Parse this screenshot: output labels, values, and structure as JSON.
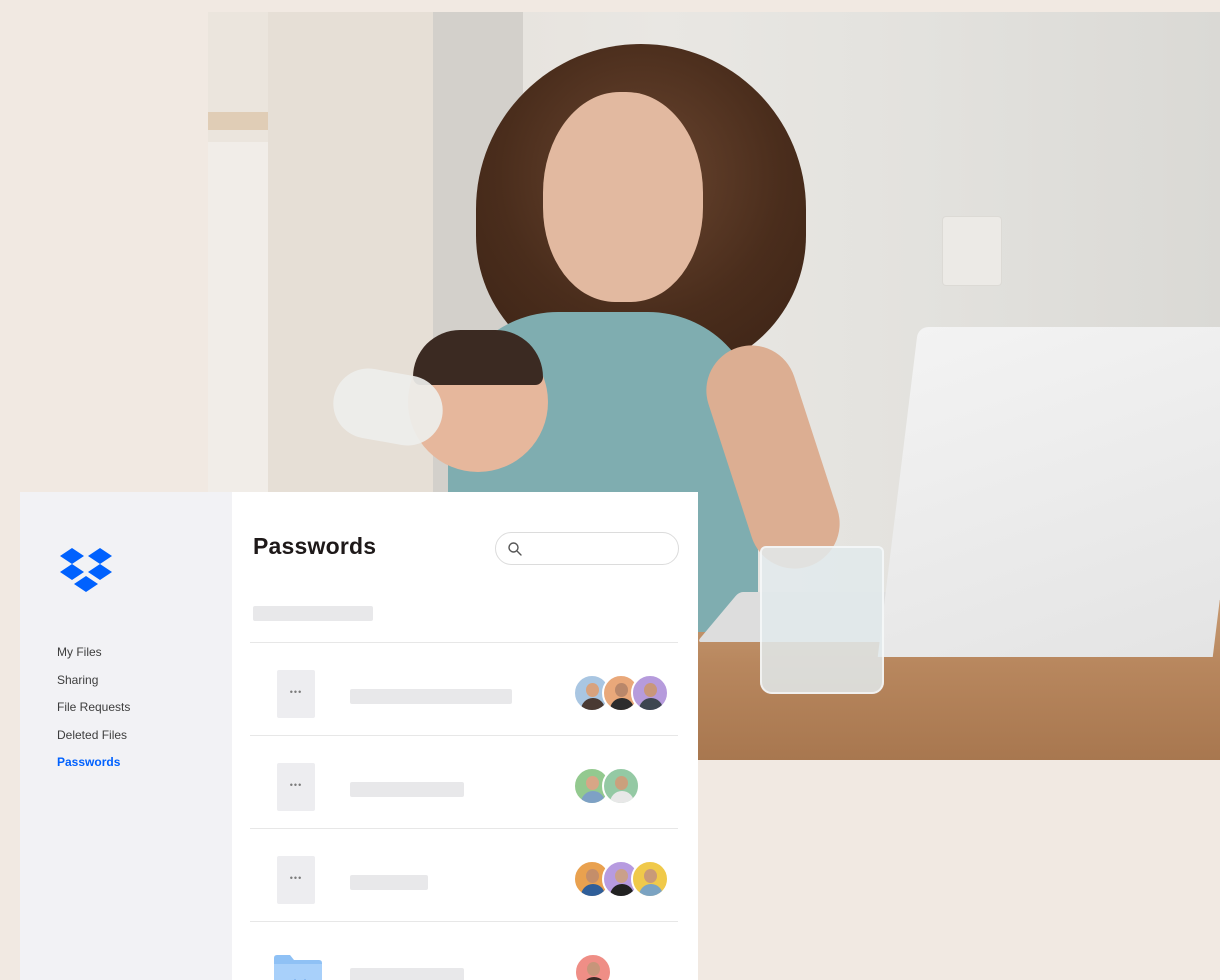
{
  "sidebar": {
    "nav": [
      "My Files",
      "Sharing",
      "File Requests",
      "Deleted Files",
      "Passwords"
    ],
    "active": "Passwords"
  },
  "main": {
    "title": "Passwords",
    "search": {
      "value": "",
      "placeholder": ""
    },
    "rows": [
      {
        "tile": "dots-icon",
        "dots": "•••",
        "avatars": [
          "#a9c6e2",
          "#e9a87a",
          "#b69bdc"
        ]
      },
      {
        "tile": "dots-icon",
        "dots": "•••",
        "avatars": [
          "#93c98f",
          "#94c9a4"
        ]
      },
      {
        "tile": "dots-icon",
        "dots": "•••",
        "avatars": [
          "#e9a14f",
          "#b79be0",
          "#f0c94a"
        ]
      },
      {
        "tile": "folder-icon",
        "avatars": [
          "#ef8e86"
        ]
      }
    ]
  },
  "colors": {
    "accent": "#0061fe",
    "sidebar_bg": "#f2f2f5",
    "page_bg": "#f1e9e2"
  }
}
